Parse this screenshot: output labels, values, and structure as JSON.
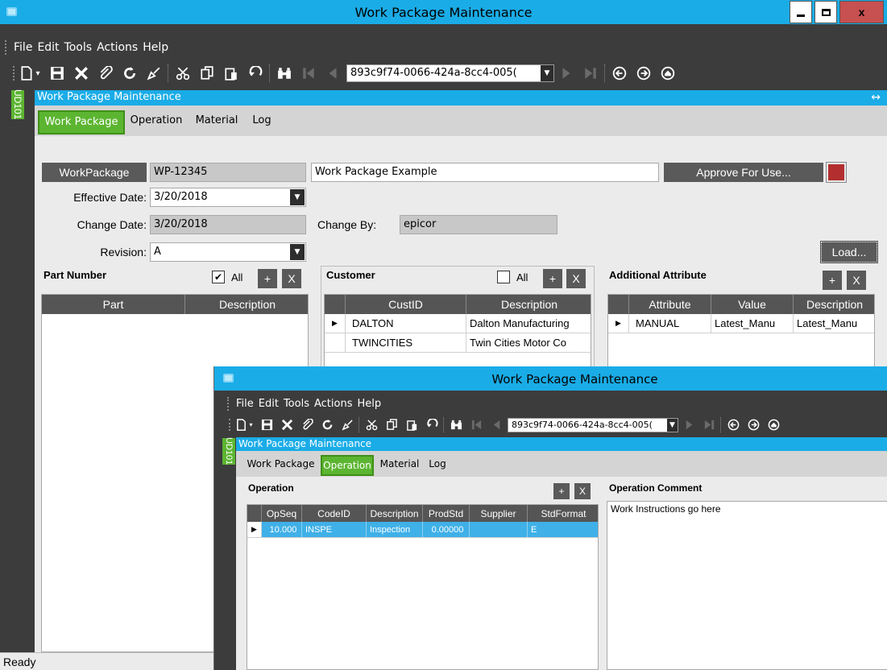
{
  "main": {
    "title": "Work Package Maintenance",
    "menu": [
      "File",
      "Edit",
      "Tools",
      "Actions",
      "Help"
    ],
    "nav_id": "893c9f74-0066-424a-8cc4-005(",
    "ud_tab": "UD101",
    "form_title": "Work Package Maintenance",
    "tabs": [
      "Work Package",
      "Operation",
      "Material",
      "Log"
    ],
    "active_tab": "Work Package",
    "form": {
      "workpackage_label": "WorkPackage",
      "workpackage_value": "WP-12345",
      "description_value": "Work Package Example",
      "approve_label": "Approve For Use...",
      "effective_date_label": "Effective Date:",
      "effective_date_value": "3/20/2018",
      "change_date_label": "Change Date:",
      "change_date_value": "3/20/2018",
      "change_by_label": "Change By:",
      "change_by_value": "epicor",
      "revision_label": "Revision:",
      "revision_value": "A",
      "load_label": "Load..."
    },
    "part_section": {
      "title": "Part Number",
      "all_label": "All",
      "all_checked": true,
      "columns": [
        "Part",
        "Description"
      ],
      "rows": []
    },
    "customer_section": {
      "title": "Customer",
      "all_label": "All",
      "all_checked": false,
      "columns": [
        "CustID",
        "Description"
      ],
      "rows": [
        {
          "custid": "DALTON",
          "description": "Dalton Manufacturing"
        },
        {
          "custid": "TWINCITIES",
          "description": "Twin Cities Motor Co"
        }
      ]
    },
    "attribute_section": {
      "title": "Additional Attribute",
      "columns": [
        "Attribute",
        "Value",
        "Description"
      ],
      "rows": [
        {
          "attribute": "MANUAL",
          "value": "Latest_Manu",
          "description": "Latest_Manu"
        }
      ]
    },
    "add_symbol": "+",
    "delete_symbol": "X",
    "status": "Ready"
  },
  "overlay": {
    "title": "Work Package Maintenance",
    "menu": [
      "File",
      "Edit",
      "Tools",
      "Actions",
      "Help"
    ],
    "nav_id": "893c9f74-0066-424a-8cc4-005(",
    "ud_tab": "UD101",
    "form_title": "Work Package Maintenance",
    "tabs": [
      "Work Package",
      "Operation",
      "Material",
      "Log"
    ],
    "active_tab": "Operation",
    "operation_section": {
      "title": "Operation",
      "columns": [
        "OpSeq",
        "CodeID",
        "Description",
        "ProdStd",
        "Supplier",
        "StdFormat"
      ],
      "rows": [
        {
          "opseq": "10.000",
          "codeid": "INSPE",
          "description": "Inspection",
          "prodstd": "0.00000",
          "supplier": "",
          "stdformat": "E"
        }
      ]
    },
    "comment_section": {
      "title": "Operation Comment",
      "text": "Work Instructions go here"
    },
    "add_symbol": "+",
    "delete_symbol": "X"
  },
  "colors": {
    "title_blue": "#1aace7",
    "dark_bar": "#3c3c3c",
    "green_tab": "#5cb531",
    "approve_swatch": "#b32f2f",
    "row_selected": "#3fb0e8"
  }
}
